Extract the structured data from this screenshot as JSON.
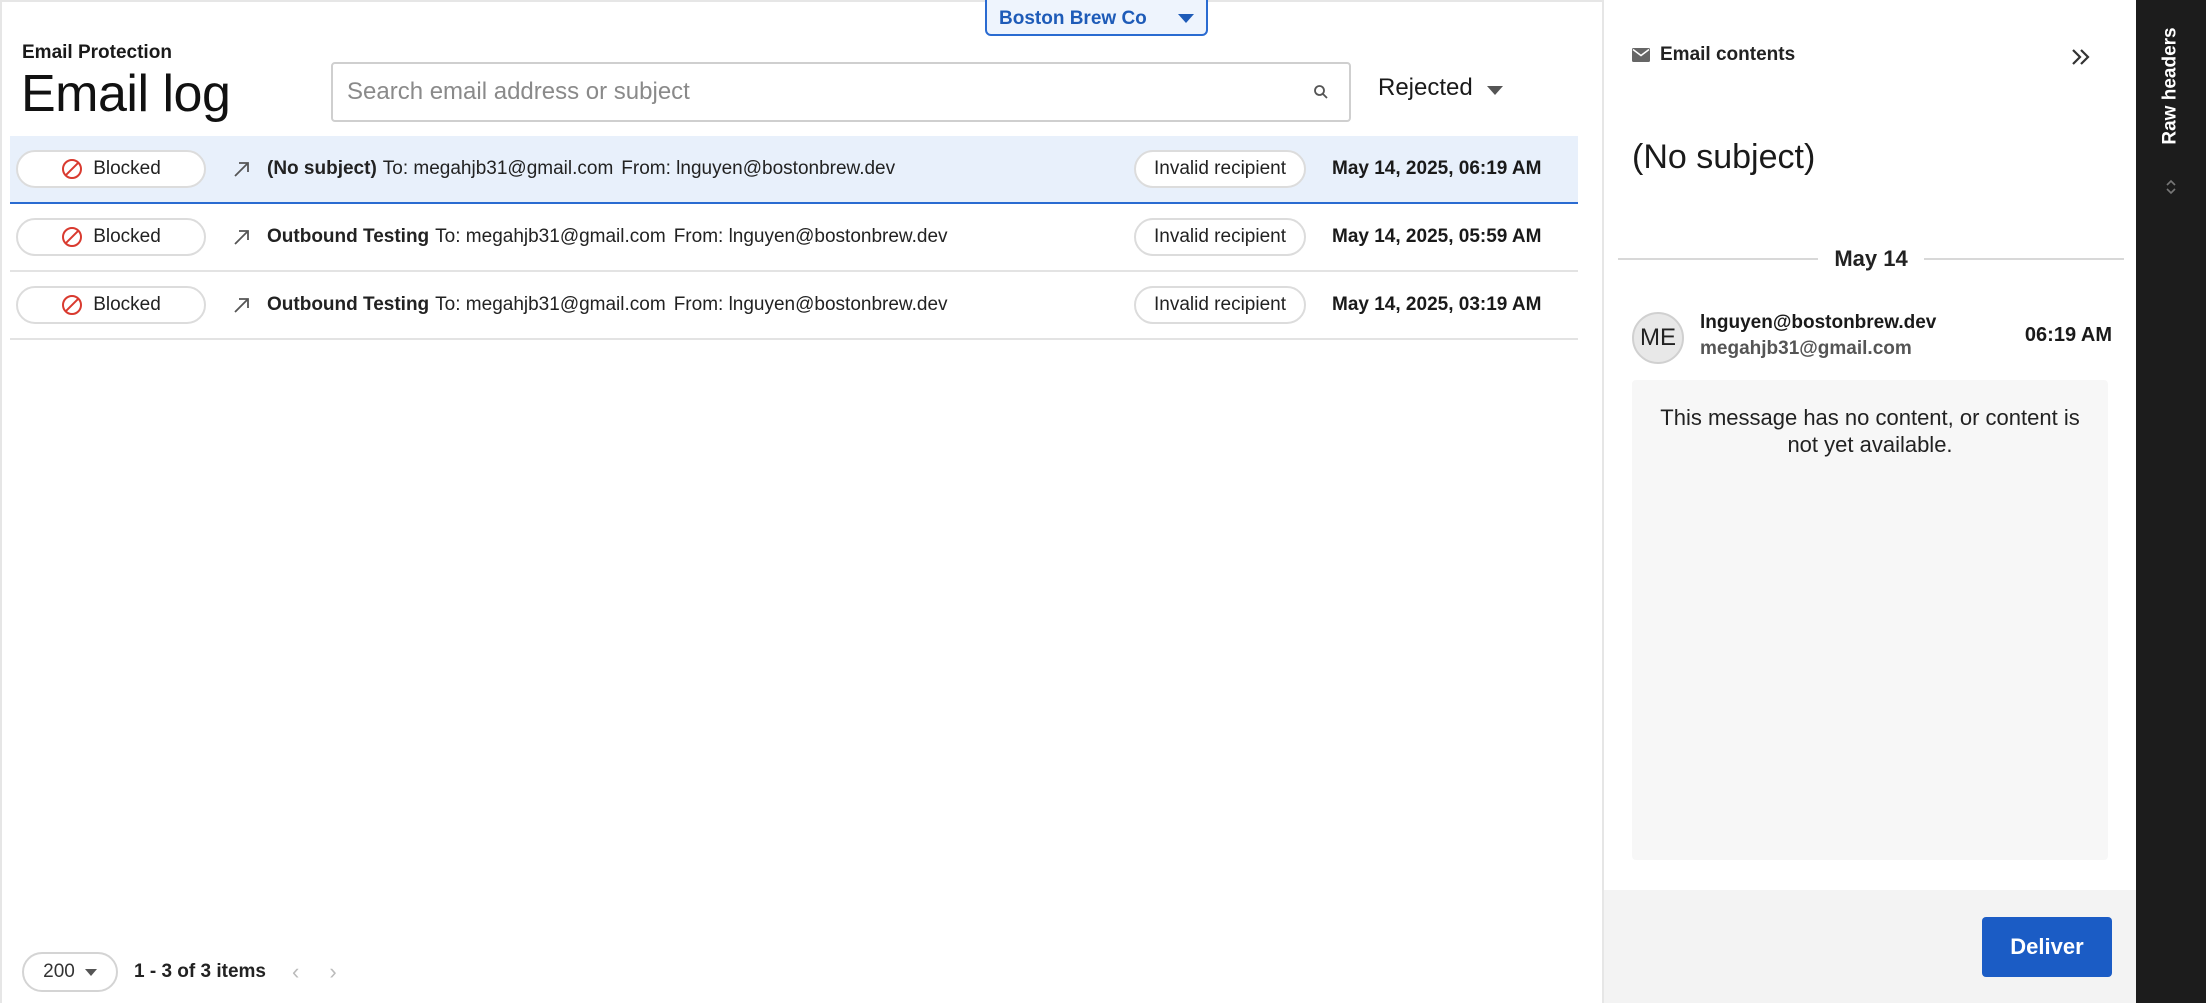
{
  "org_selector": {
    "label": "Boston Brew Co"
  },
  "header": {
    "product": "Email Protection",
    "title": "Email log"
  },
  "search": {
    "placeholder": "Search email address or subject",
    "value": ""
  },
  "filter": {
    "label": "Rejected"
  },
  "rows": [
    {
      "status": "Blocked",
      "subject": "(No subject)",
      "to": "To: megahjb31@gmail.com",
      "from": "From: lnguyen@bostonbrew.dev",
      "reason": "Invalid recipient",
      "date": "May 14, 2025, 06:19 AM"
    },
    {
      "status": "Blocked",
      "subject": "Outbound Testing",
      "to": "To: megahjb31@gmail.com",
      "from": "From: lnguyen@bostonbrew.dev",
      "reason": "Invalid recipient",
      "date": "May 14, 2025, 05:59 AM"
    },
    {
      "status": "Blocked",
      "subject": "Outbound Testing",
      "to": "To: megahjb31@gmail.com",
      "from": "From: lnguyen@bostonbrew.dev",
      "reason": "Invalid recipient",
      "date": "May 14, 2025, 03:19 AM"
    }
  ],
  "footer": {
    "page_size": "200",
    "page_info": "1 - 3 of 3 items",
    "prev": "‹",
    "next": "›"
  },
  "detail": {
    "header": "Email contents",
    "subject": "(No subject)",
    "date_group": "May 14",
    "avatar_initials": "ME",
    "from": "lnguyen@bostonbrew.dev",
    "to": "megahjb31@gmail.com",
    "time": "06:19 AM",
    "message": "This message has no content, or content is not yet available.",
    "deliver_label": "Deliver"
  },
  "rail": {
    "raw_headers_label": "Raw headers"
  },
  "colors": {
    "accent": "#1b5cc5",
    "selected_row": "#e8f0fb",
    "blocked_icon": "#d93a2f",
    "rail_bg": "#1c1c1c"
  },
  "icons": {
    "search": "search-icon",
    "blocked": "blocked-icon",
    "outbound": "outbound-arrow-icon",
    "collapse": "double-chevron-right-icon",
    "mail": "mail-icon",
    "sort": "sort-icon"
  }
}
